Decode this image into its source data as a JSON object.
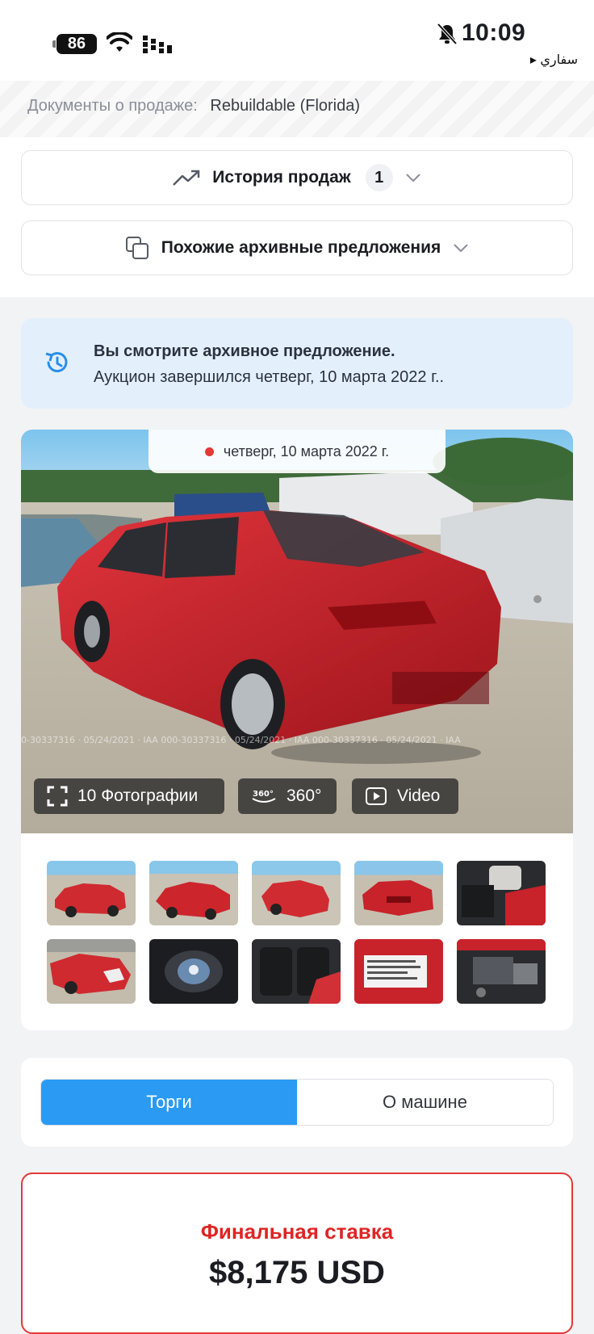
{
  "status_bar": {
    "battery": "86",
    "time": "10:09",
    "back_app": "سفاري ▸"
  },
  "sale_documents": {
    "label": "Документы о продаже:",
    "value": "Rebuildable (Florida)"
  },
  "sales_history": {
    "label": "История продаж",
    "count": "1"
  },
  "similar_archived": {
    "label": "Похожие архивные предложения"
  },
  "archive_notice": {
    "title": "Вы смотрите архивное предложение.",
    "subtitle": "Аукцион завершился четверг, 10 марта 2022 г.."
  },
  "gallery": {
    "date": "четверг, 10 марта 2022 г.",
    "photos_button": "10 Фотографии",
    "view360_button": "360°",
    "video_button": "Video",
    "icon_360_text": "360°",
    "thumbnails": [
      {
        "alt": "thumb-front-left"
      },
      {
        "alt": "thumb-rear-left"
      },
      {
        "alt": "thumb-rear-left-2"
      },
      {
        "alt": "thumb-rear"
      },
      {
        "alt": "thumb-interior-front"
      },
      {
        "alt": "thumb-front-damage"
      },
      {
        "alt": "thumb-dashboard"
      },
      {
        "alt": "thumb-rear-seats"
      },
      {
        "alt": "thumb-label"
      },
      {
        "alt": "thumb-engine"
      }
    ]
  },
  "tabs": {
    "active": "Торги",
    "inactive": "О машине"
  },
  "final_bid": {
    "title": "Финальная ставка",
    "amount": "$8,175 USD"
  },
  "colors": {
    "accent_blue": "#2a9af3",
    "notice_bg": "#e3f0fb",
    "final_red": "#e02424",
    "car_red": "#c8232c"
  }
}
